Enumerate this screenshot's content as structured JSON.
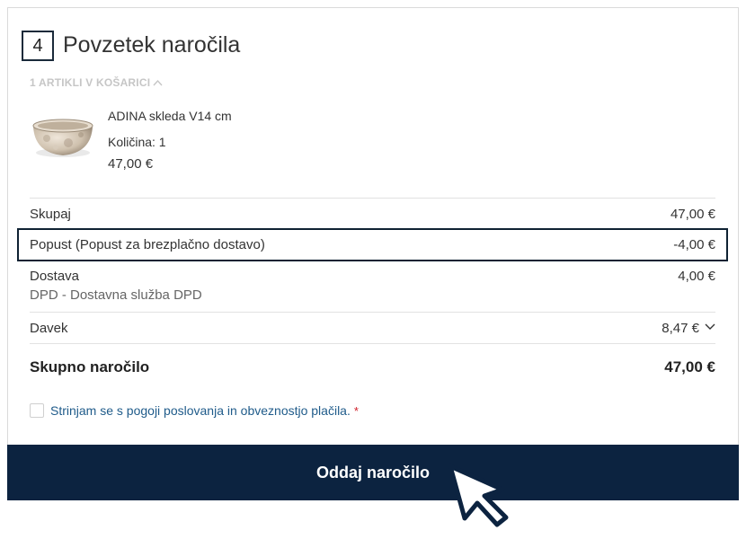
{
  "step": {
    "number": "4",
    "title": "Povzetek naročila"
  },
  "cart": {
    "count_label": "1 ARTIKLI V KOŠARICI",
    "toggle_icon": "chevron-up-icon",
    "items": [
      {
        "name": "ADINA skleda V14 cm",
        "quantity": "Količina: 1",
        "price": "47,00 €"
      }
    ]
  },
  "summary": {
    "subtotal_label": "Skupaj",
    "subtotal_value": "47,00 €",
    "discount_label": "Popust (Popust za brezplačno dostavo)",
    "discount_value": "-4,00 €",
    "shipping_label": "Dostava",
    "shipping_method": "DPD - Dostavna služba DPD",
    "shipping_value": "4,00 €",
    "tax_label": "Davek",
    "tax_value": "8,47 €",
    "tax_toggle_icon": "chevron-down-icon",
    "total_label": "Skupno naročilo",
    "total_value": "47,00 €"
  },
  "terms": {
    "label": "Strinjam se s pogoji poslovanja in obveznostjo plačila.",
    "required_mark": "*"
  },
  "submit": {
    "label": "Oddaj naročilo"
  },
  "colors": {
    "button_bg": "#0c2340",
    "link": "#1f5b8a",
    "required": "#d0202a",
    "highlight_border": "#0f2233"
  }
}
